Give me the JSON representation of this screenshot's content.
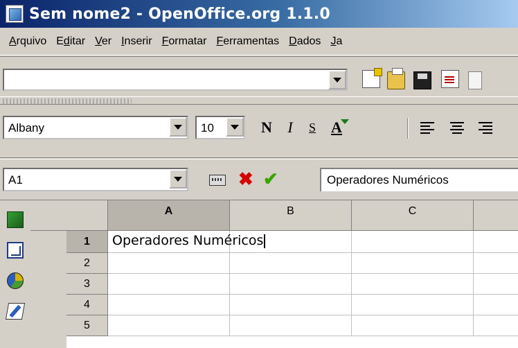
{
  "window": {
    "title": "Sem nome2 - OpenOffice.org 1.1.0"
  },
  "menu": {
    "items": [
      {
        "label_ul": "A",
        "label_rest": "rquivo"
      },
      {
        "label_ul": "",
        "label_pre": "E",
        "label_ul2": "d",
        "label_rest": "itar"
      },
      {
        "label_ul": "V",
        "label_rest": "er"
      },
      {
        "label_ul": "I",
        "label_rest": "nserir"
      },
      {
        "label_ul": "F",
        "label_rest": "ormatar"
      },
      {
        "label_ul": "F",
        "label_rest": "erramentas"
      },
      {
        "label_ul": "D",
        "label_rest": "ados"
      },
      {
        "label_ul": "J",
        "label_rest": "a"
      }
    ]
  },
  "function_bar": {
    "url_value": ""
  },
  "format_bar": {
    "font_name": "Albany",
    "font_size": "10",
    "bold_label": "N",
    "italic_label": "I",
    "underline_label": "S",
    "color_label": "A"
  },
  "formula_bar": {
    "name_box": "A1",
    "cancel_glyph": "✖",
    "accept_glyph": "✔",
    "content": "Operadores Numéricos"
  },
  "sheet": {
    "columns": [
      "A",
      "B",
      "C"
    ],
    "rows": [
      "1",
      "2",
      "3",
      "4",
      "5"
    ],
    "active_cell": "A1",
    "a1_value": "Operadores Numéricos"
  },
  "colors": {
    "title_gradient_start": "#0a246a",
    "title_gradient_end": "#a6caf0",
    "chrome": "#d4d0c8"
  }
}
